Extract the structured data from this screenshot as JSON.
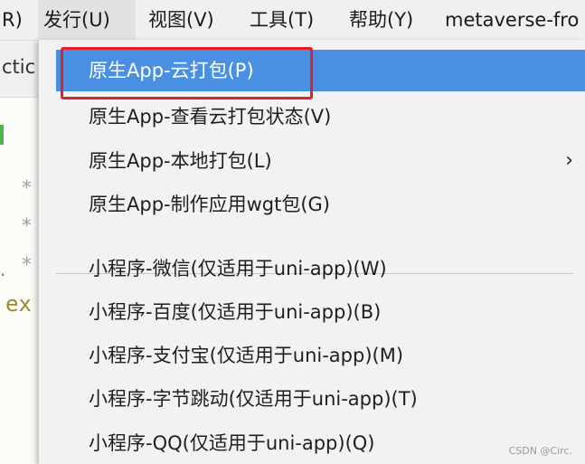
{
  "menubar": {
    "items": [
      {
        "label": "R)"
      },
      {
        "label": "发行(U)"
      },
      {
        "label": "视图(V)"
      },
      {
        "label": "工具(T)"
      },
      {
        "label": "帮助(Y)"
      },
      {
        "label": "metaverse-fro"
      }
    ]
  },
  "editor": {
    "tab_fragment": "ctic",
    "code_star": "*",
    "code_dot": ".",
    "code_keyword": "ex"
  },
  "dropdown": {
    "items": [
      {
        "label": "原生App-云打包(P)"
      },
      {
        "label": "原生App-查看云打包状态(V)"
      },
      {
        "label": "原生App-本地打包(L)",
        "submenu_arrow": "›"
      },
      {
        "label": "原生App-制作应用wgt包(G)"
      },
      {
        "label": "小程序-微信(仅适用于uni-app)(W)"
      },
      {
        "label": "小程序-百度(仅适用于uni-app)(B)"
      },
      {
        "label": "小程序-支付宝(仅适用于uni-app)(M)"
      },
      {
        "label": "小程序-字节跳动(仅适用于uni-app)(T)"
      },
      {
        "label": "小程序-QQ(仅适用于uni-app)(Q)"
      }
    ]
  },
  "watermark": "CSDN @Circ.",
  "colors": {
    "highlight": "#4a90e2",
    "annotation_box": "#e0202a"
  }
}
